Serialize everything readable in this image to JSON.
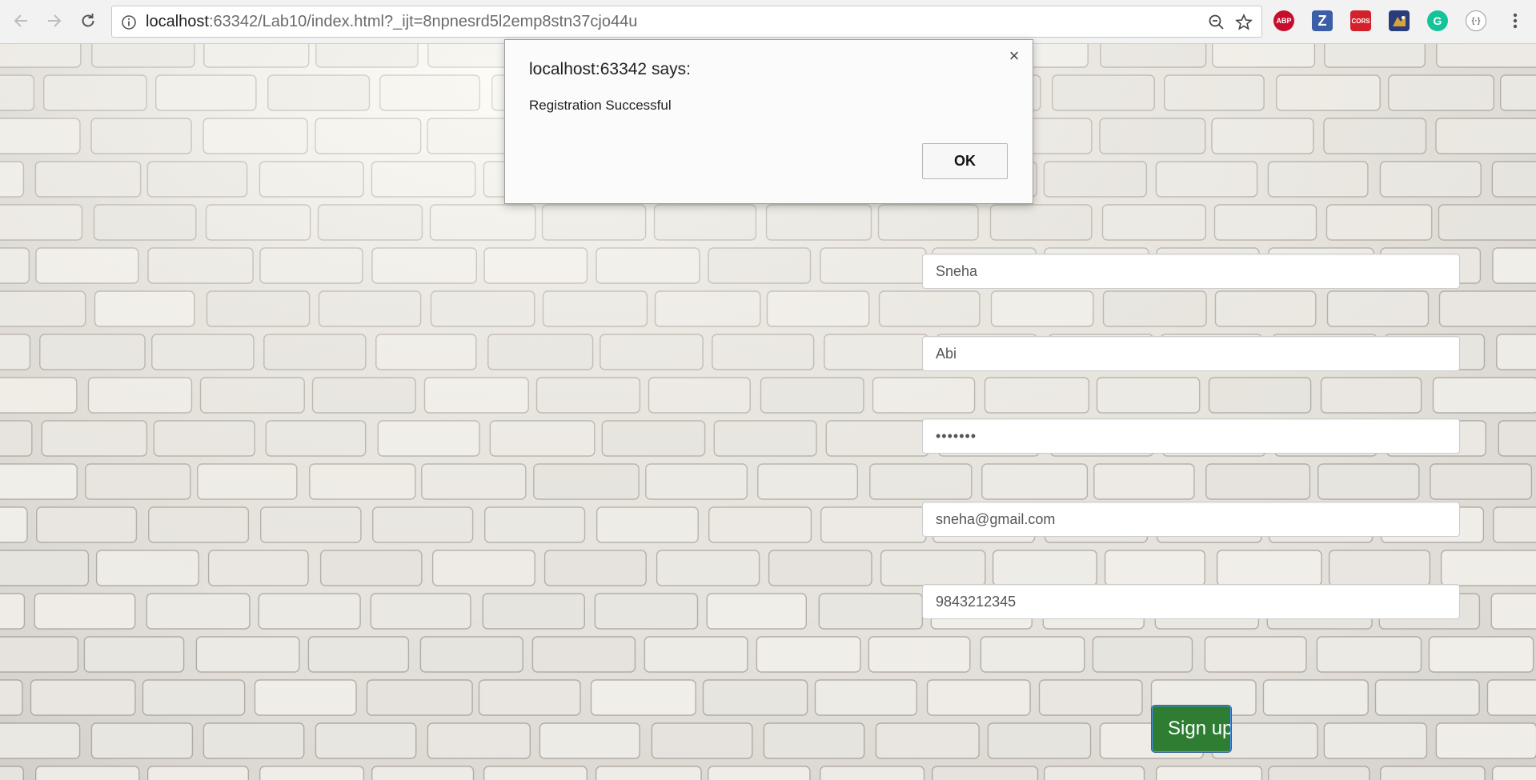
{
  "browser": {
    "url_host": "localhost",
    "url_rest": ":63342/Lab10/index.html?_ijt=8npnesrd5l2emp8stn37cjo44u",
    "nav_icons": [
      "back-arrow-icon",
      "forward-arrow-icon",
      "reload-icon"
    ],
    "omnibox_icons": [
      "info-icon",
      "zoom-out-icon",
      "bookmark-star-icon"
    ],
    "extensions": [
      {
        "name": "adblock-plus-extension-icon",
        "label": "ABP",
        "color": "#c70d2c"
      },
      {
        "name": "zotero-extension-icon",
        "label": "Z",
        "color": "#3b5ea6"
      },
      {
        "name": "cors-extension-icon",
        "label": "CORS",
        "color": "#d3212c"
      },
      {
        "name": "sky-extension-icon",
        "label": "",
        "color": "#2a3c7a"
      },
      {
        "name": "grammarly-extension-icon",
        "label": "G",
        "color": "#15c39a"
      },
      {
        "name": "json-viewer-extension-icon",
        "label": "{·}",
        "color": "#9e9e9e"
      }
    ],
    "menu_icon": "kebab-menu-icon"
  },
  "dialog": {
    "title": "localhost:63342 says:",
    "message": "Registration Successful",
    "ok_label": "OK",
    "close_glyph": "×"
  },
  "form": {
    "first_name": "Sneha",
    "last_name": "Abi",
    "password": "•••••••",
    "email": "sneha@gmail.com",
    "phone": "9843212345",
    "submit_label": "Sign up",
    "submit_color": "#2e7d32"
  }
}
